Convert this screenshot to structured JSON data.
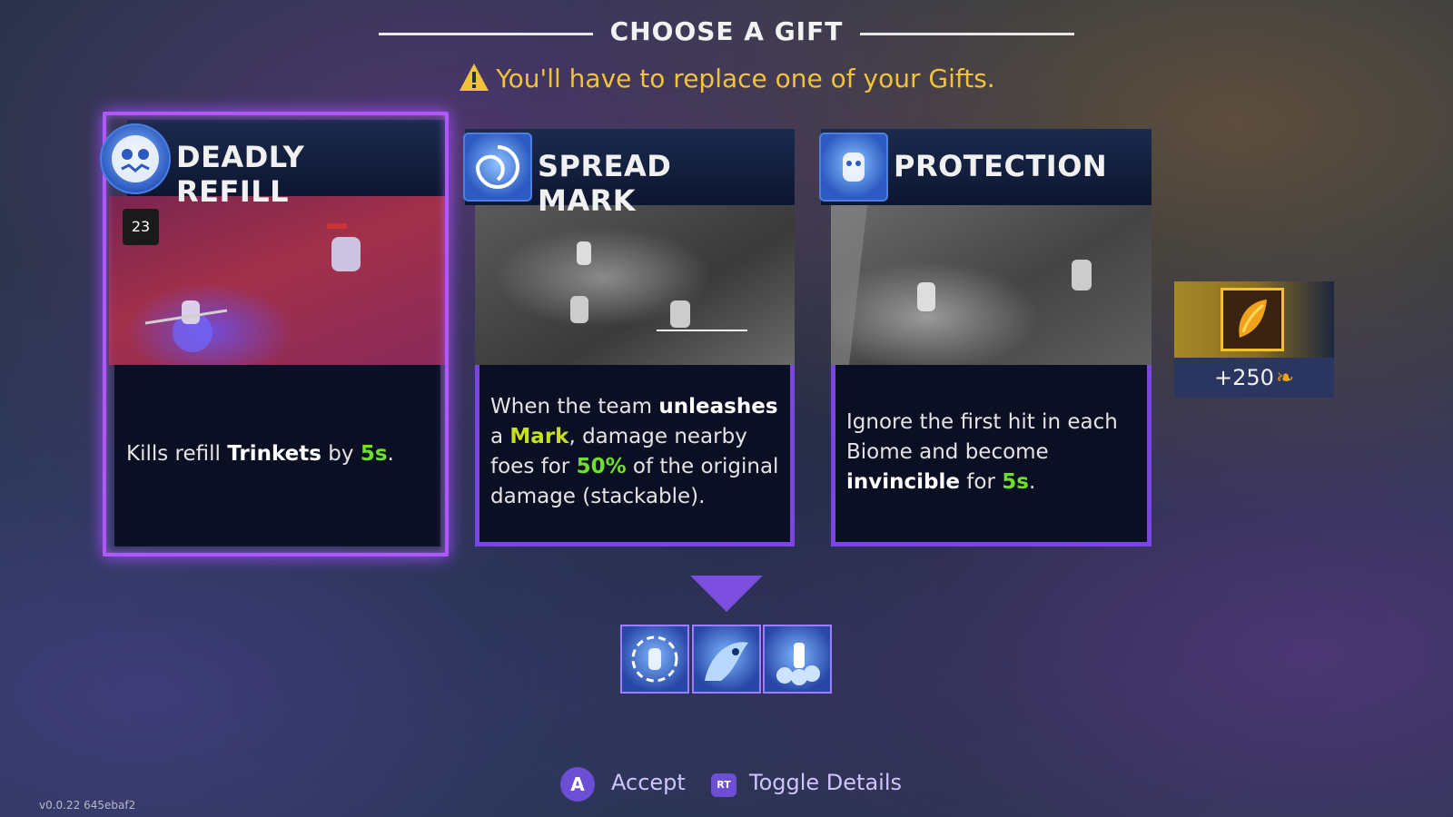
{
  "header": {
    "title": "CHOOSE A GIFT",
    "warning": "You'll have to replace one of your Gifts."
  },
  "cards": [
    {
      "title": "DEADLY REFILL",
      "selected": true,
      "count_badge": "23",
      "desc": {
        "t1": "Kills refill ",
        "b1": "Trinkets",
        "t2": " by ",
        "g1": "5s",
        "t3": "."
      }
    },
    {
      "title": "SPREAD MARK",
      "selected": false,
      "desc": {
        "t1": "When the team ",
        "b1": "unleashes",
        "t2": " a ",
        "y1": "Mark",
        "t3": ", damage nearby foes for ",
        "g1": "50%",
        "t4": " of the original damage (stackable)."
      }
    },
    {
      "title": "PROTECTION",
      "selected": false,
      "desc": {
        "t1": "Ignore the first hit in each Biome and become ",
        "b1": "invincible",
        "t2": " for ",
        "g1": "5s",
        "t3": "."
      }
    }
  ],
  "currency": {
    "amount": "+250"
  },
  "current_gifts": [
    {
      "icon": "warrior-gift-icon"
    },
    {
      "icon": "dragon-gift-icon"
    },
    {
      "icon": "treasure-gift-icon"
    }
  ],
  "controls": {
    "accept_button": "A",
    "accept_label": "Accept",
    "toggle_button": "RT",
    "toggle_label": "Toggle Details"
  },
  "version": "v0.0.22 645ebaf2",
  "colors": {
    "accent_purple": "#b057ff",
    "warning_yellow": "#f2c23a",
    "highlight_green": "#6ee02a",
    "highlight_yellow": "#c4e020"
  }
}
